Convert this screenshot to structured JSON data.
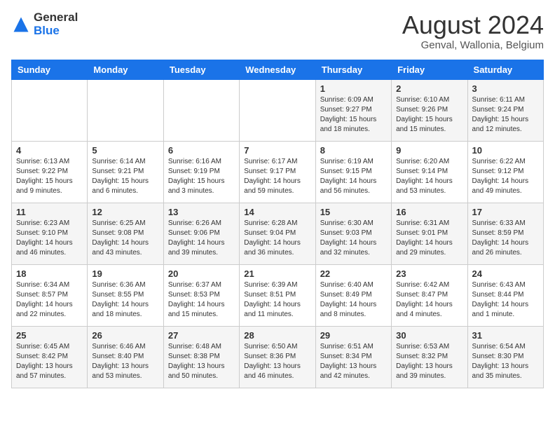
{
  "logo": {
    "general": "General",
    "blue": "Blue"
  },
  "title": {
    "month_year": "August 2024",
    "location": "Genval, Wallonia, Belgium"
  },
  "days_of_week": [
    "Sunday",
    "Monday",
    "Tuesday",
    "Wednesday",
    "Thursday",
    "Friday",
    "Saturday"
  ],
  "weeks": [
    [
      {
        "day": "",
        "info": ""
      },
      {
        "day": "",
        "info": ""
      },
      {
        "day": "",
        "info": ""
      },
      {
        "day": "",
        "info": ""
      },
      {
        "day": "1",
        "info": "Sunrise: 6:09 AM\nSunset: 9:27 PM\nDaylight: 15 hours\nand 18 minutes."
      },
      {
        "day": "2",
        "info": "Sunrise: 6:10 AM\nSunset: 9:26 PM\nDaylight: 15 hours\nand 15 minutes."
      },
      {
        "day": "3",
        "info": "Sunrise: 6:11 AM\nSunset: 9:24 PM\nDaylight: 15 hours\nand 12 minutes."
      }
    ],
    [
      {
        "day": "4",
        "info": "Sunrise: 6:13 AM\nSunset: 9:22 PM\nDaylight: 15 hours\nand 9 minutes."
      },
      {
        "day": "5",
        "info": "Sunrise: 6:14 AM\nSunset: 9:21 PM\nDaylight: 15 hours\nand 6 minutes."
      },
      {
        "day": "6",
        "info": "Sunrise: 6:16 AM\nSunset: 9:19 PM\nDaylight: 15 hours\nand 3 minutes."
      },
      {
        "day": "7",
        "info": "Sunrise: 6:17 AM\nSunset: 9:17 PM\nDaylight: 14 hours\nand 59 minutes."
      },
      {
        "day": "8",
        "info": "Sunrise: 6:19 AM\nSunset: 9:15 PM\nDaylight: 14 hours\nand 56 minutes."
      },
      {
        "day": "9",
        "info": "Sunrise: 6:20 AM\nSunset: 9:14 PM\nDaylight: 14 hours\nand 53 minutes."
      },
      {
        "day": "10",
        "info": "Sunrise: 6:22 AM\nSunset: 9:12 PM\nDaylight: 14 hours\nand 49 minutes."
      }
    ],
    [
      {
        "day": "11",
        "info": "Sunrise: 6:23 AM\nSunset: 9:10 PM\nDaylight: 14 hours\nand 46 minutes."
      },
      {
        "day": "12",
        "info": "Sunrise: 6:25 AM\nSunset: 9:08 PM\nDaylight: 14 hours\nand 43 minutes."
      },
      {
        "day": "13",
        "info": "Sunrise: 6:26 AM\nSunset: 9:06 PM\nDaylight: 14 hours\nand 39 minutes."
      },
      {
        "day": "14",
        "info": "Sunrise: 6:28 AM\nSunset: 9:04 PM\nDaylight: 14 hours\nand 36 minutes."
      },
      {
        "day": "15",
        "info": "Sunrise: 6:30 AM\nSunset: 9:03 PM\nDaylight: 14 hours\nand 32 minutes."
      },
      {
        "day": "16",
        "info": "Sunrise: 6:31 AM\nSunset: 9:01 PM\nDaylight: 14 hours\nand 29 minutes."
      },
      {
        "day": "17",
        "info": "Sunrise: 6:33 AM\nSunset: 8:59 PM\nDaylight: 14 hours\nand 26 minutes."
      }
    ],
    [
      {
        "day": "18",
        "info": "Sunrise: 6:34 AM\nSunset: 8:57 PM\nDaylight: 14 hours\nand 22 minutes."
      },
      {
        "day": "19",
        "info": "Sunrise: 6:36 AM\nSunset: 8:55 PM\nDaylight: 14 hours\nand 18 minutes."
      },
      {
        "day": "20",
        "info": "Sunrise: 6:37 AM\nSunset: 8:53 PM\nDaylight: 14 hours\nand 15 minutes."
      },
      {
        "day": "21",
        "info": "Sunrise: 6:39 AM\nSunset: 8:51 PM\nDaylight: 14 hours\nand 11 minutes."
      },
      {
        "day": "22",
        "info": "Sunrise: 6:40 AM\nSunset: 8:49 PM\nDaylight: 14 hours\nand 8 minutes."
      },
      {
        "day": "23",
        "info": "Sunrise: 6:42 AM\nSunset: 8:47 PM\nDaylight: 14 hours\nand 4 minutes."
      },
      {
        "day": "24",
        "info": "Sunrise: 6:43 AM\nSunset: 8:44 PM\nDaylight: 14 hours\nand 1 minute."
      }
    ],
    [
      {
        "day": "25",
        "info": "Sunrise: 6:45 AM\nSunset: 8:42 PM\nDaylight: 13 hours\nand 57 minutes."
      },
      {
        "day": "26",
        "info": "Sunrise: 6:46 AM\nSunset: 8:40 PM\nDaylight: 13 hours\nand 53 minutes."
      },
      {
        "day": "27",
        "info": "Sunrise: 6:48 AM\nSunset: 8:38 PM\nDaylight: 13 hours\nand 50 minutes."
      },
      {
        "day": "28",
        "info": "Sunrise: 6:50 AM\nSunset: 8:36 PM\nDaylight: 13 hours\nand 46 minutes."
      },
      {
        "day": "29",
        "info": "Sunrise: 6:51 AM\nSunset: 8:34 PM\nDaylight: 13 hours\nand 42 minutes."
      },
      {
        "day": "30",
        "info": "Sunrise: 6:53 AM\nSunset: 8:32 PM\nDaylight: 13 hours\nand 39 minutes."
      },
      {
        "day": "31",
        "info": "Sunrise: 6:54 AM\nSunset: 8:30 PM\nDaylight: 13 hours\nand 35 minutes."
      }
    ]
  ]
}
